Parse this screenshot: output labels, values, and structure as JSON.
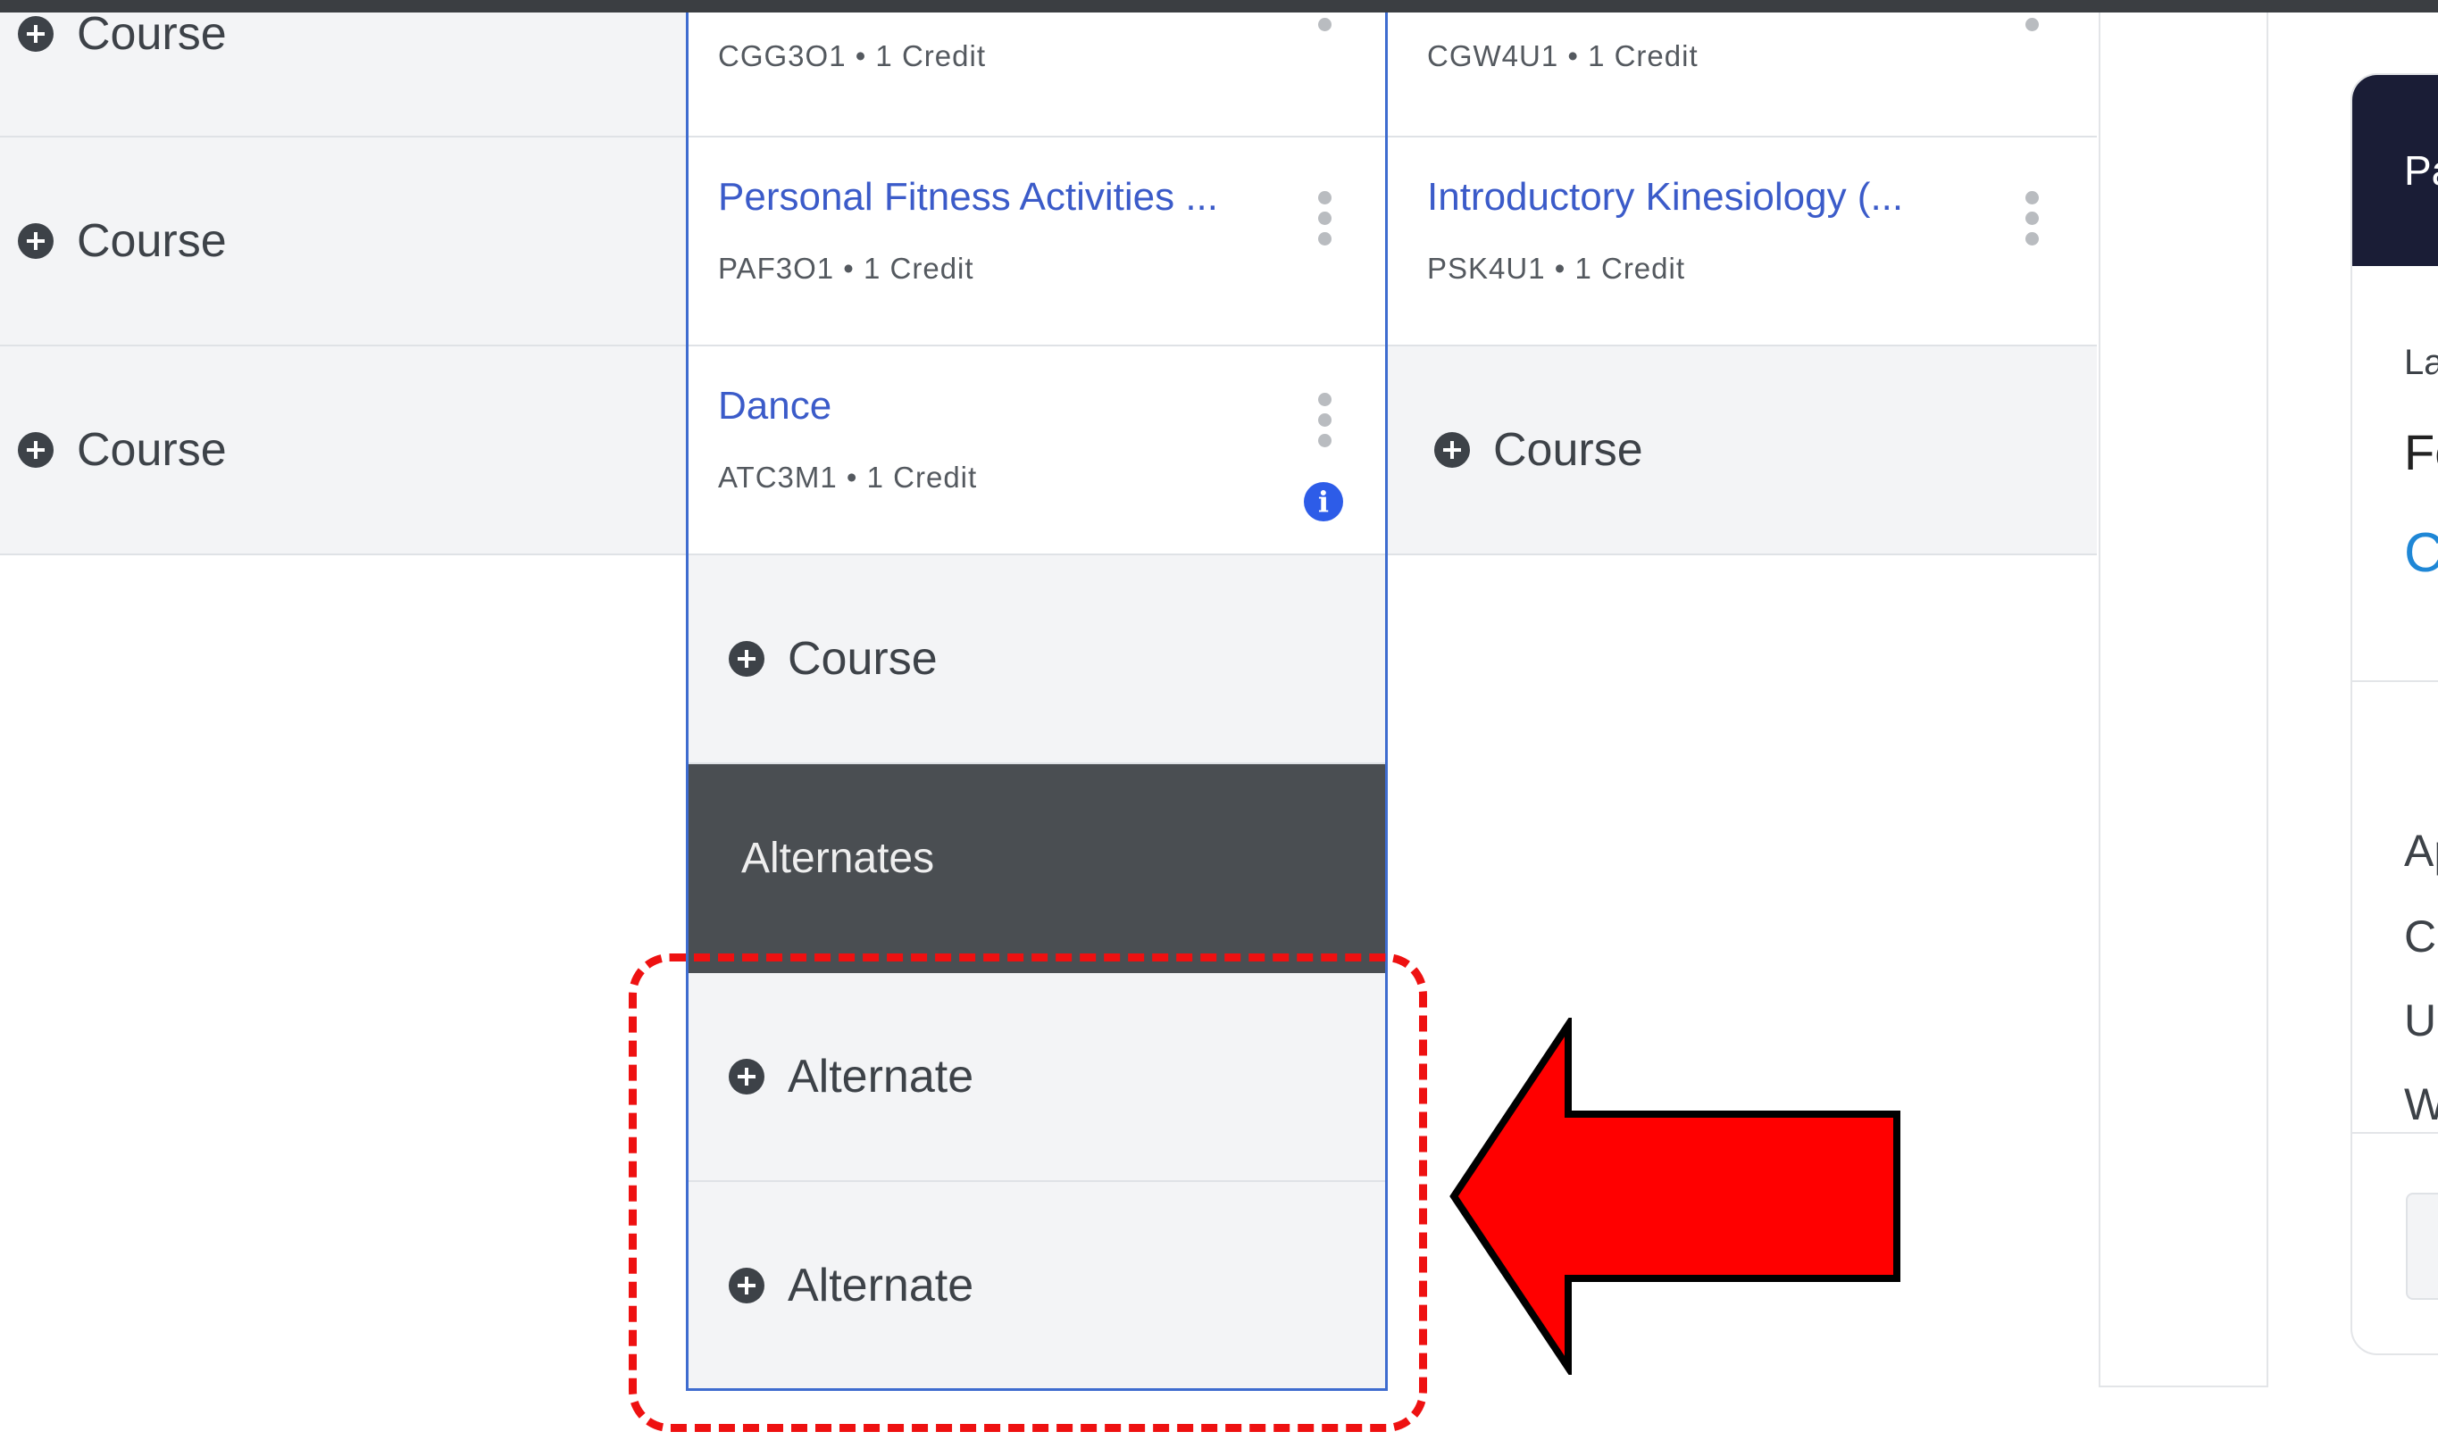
{
  "grid": {
    "col1": {
      "rows": [
        {
          "label": "Course"
        },
        {
          "label": "Course"
        },
        {
          "label": "Course"
        }
      ]
    },
    "col2": {
      "courses": [
        {
          "title": "",
          "code_credit": "CGG3O1 • 1 Credit"
        },
        {
          "title": "Personal Fitness Activities ...",
          "code_credit": "PAF3O1 • 1 Credit"
        },
        {
          "title": "Dance",
          "code_credit": "ATC3M1 • 1 Credit",
          "info": "i"
        }
      ],
      "add_course_label": "Course",
      "alternates_header": "Alternates",
      "alternates": [
        {
          "label": "Alternate"
        },
        {
          "label": "Alternate"
        }
      ]
    },
    "col3": {
      "courses": [
        {
          "title": "",
          "code_credit": "CGW4U1 • 1 Credit"
        },
        {
          "title": "Introductory Kinesiology (...",
          "code_credit": "PSK4U1 • 1 Credit"
        }
      ],
      "add_course_label": "Course"
    }
  },
  "side_panel": {
    "header": "Pa",
    "label": "La",
    "value": "Fe",
    "link": "C",
    "lines": [
      "Ap",
      "C",
      "U",
      "W"
    ]
  },
  "colors": {
    "link_blue": "#3b5bc9",
    "header_dark": "#4a4e52",
    "panel_navy": "#1a1d36",
    "highlight_red": "#ee1111"
  }
}
